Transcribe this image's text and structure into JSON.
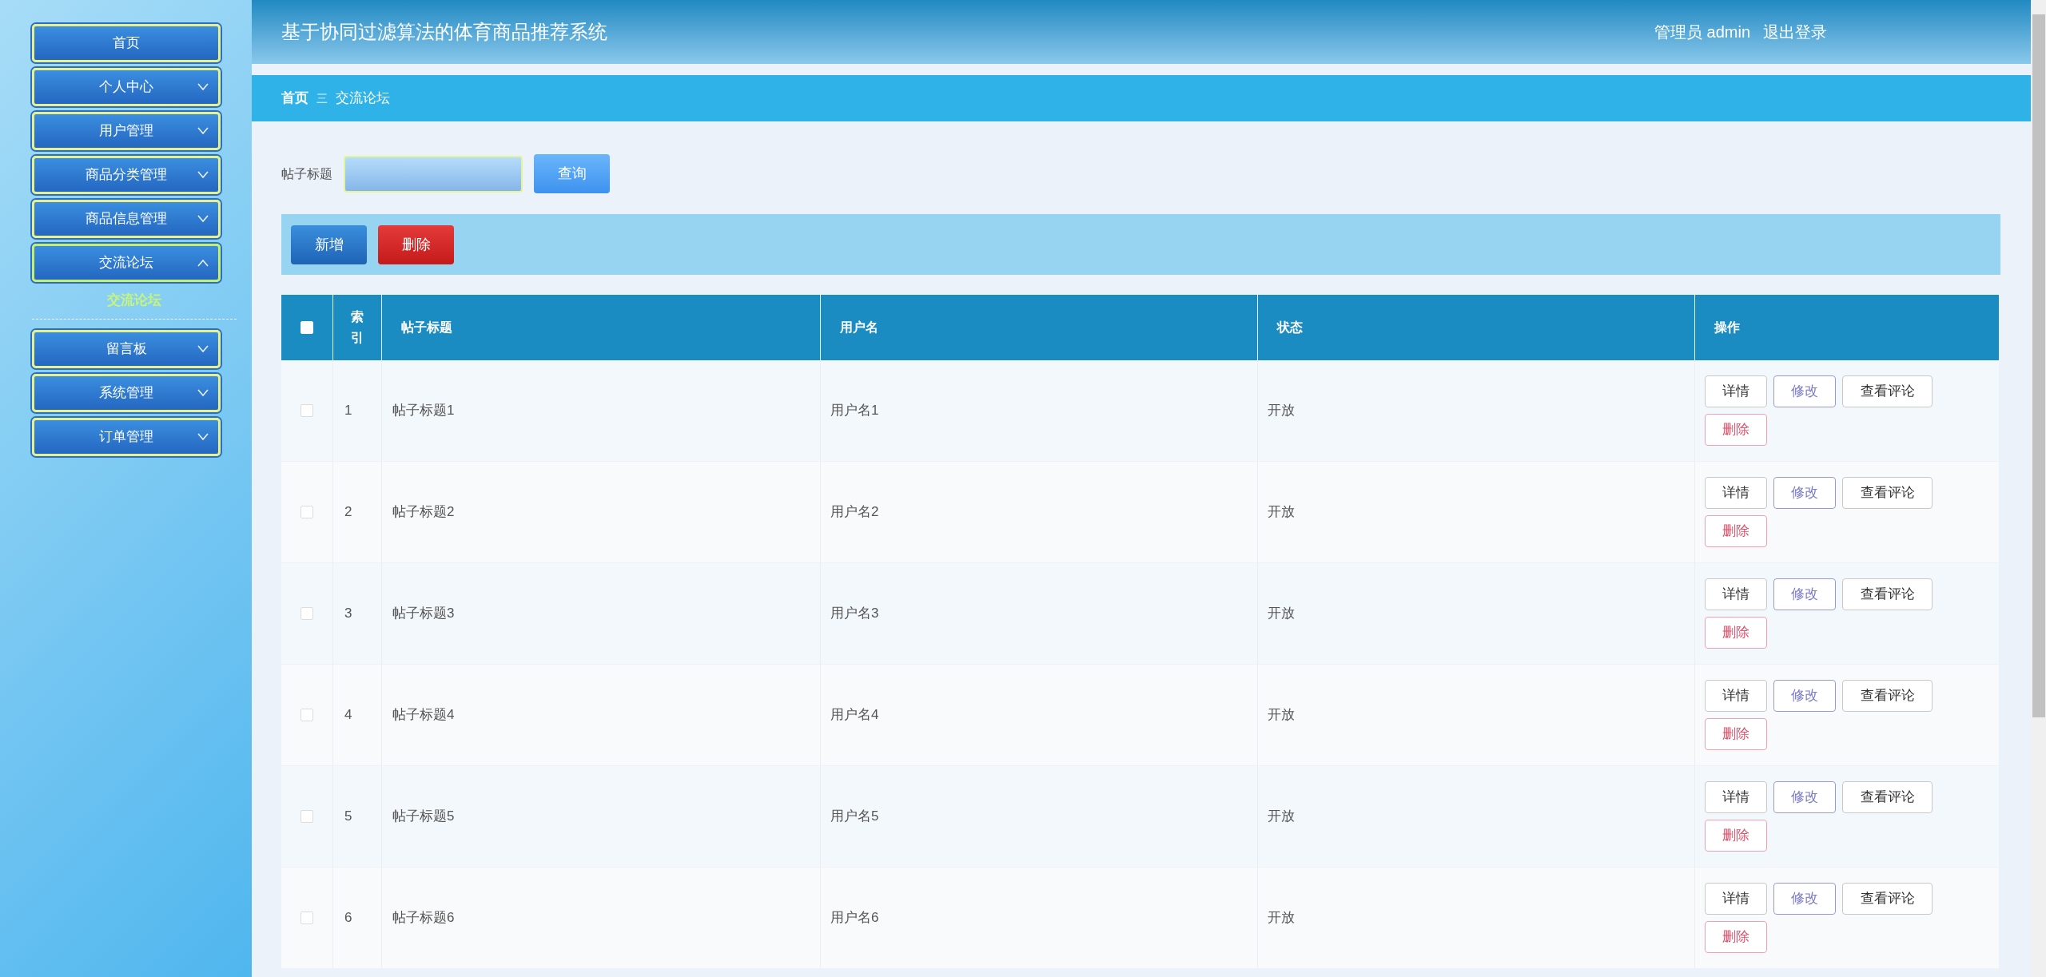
{
  "sidebar": {
    "items": [
      {
        "label": "首页",
        "kind": "link",
        "expanded": false
      },
      {
        "label": "个人中心",
        "kind": "menu",
        "expanded": false
      },
      {
        "label": "用户管理",
        "kind": "menu",
        "expanded": false
      },
      {
        "label": "商品分类管理",
        "kind": "menu",
        "expanded": false
      },
      {
        "label": "商品信息管理",
        "kind": "menu",
        "expanded": false
      },
      {
        "label": "交流论坛",
        "kind": "menu",
        "expanded": true,
        "children": [
          {
            "label": "交流论坛",
            "selected": true
          }
        ]
      },
      {
        "label": "留言板",
        "kind": "menu",
        "expanded": false
      },
      {
        "label": "系统管理",
        "kind": "menu",
        "expanded": false
      },
      {
        "label": "订单管理",
        "kind": "menu",
        "expanded": false
      }
    ]
  },
  "header": {
    "title": "基于协同过滤算法的体育商品推荐系统",
    "user": "管理员 admin",
    "logout": "退出登录"
  },
  "breadcrumb": {
    "home": "首页",
    "separator": "三",
    "current": "交流论坛"
  },
  "search": {
    "label": "帖子标题",
    "button": "查询"
  },
  "actions": [
    "新增",
    "删除"
  ],
  "table": {
    "select_all": {
      "checked": false
    },
    "columns": [
      "索引",
      "帖子标题",
      "用户名",
      "状态",
      "操作"
    ],
    "rows": [
      {
        "checked": false,
        "index": "1",
        "title": "帖子标题1",
        "username": "用户名1",
        "status": "开放",
        "buttons": [
          "详情",
          "修改",
          "查看评论",
          "删除"
        ]
      },
      {
        "checked": false,
        "index": "2",
        "title": "帖子标题2",
        "username": "用户名2",
        "status": "开放",
        "buttons": [
          "详情",
          "修改",
          "查看评论",
          "删除"
        ]
      },
      {
        "checked": false,
        "index": "3",
        "title": "帖子标题3",
        "username": "用户名3",
        "status": "开放",
        "buttons": [
          "详情",
          "修改",
          "查看评论",
          "删除"
        ]
      },
      {
        "checked": false,
        "index": "4",
        "title": "帖子标题4",
        "username": "用户名4",
        "status": "开放",
        "buttons": [
          "详情",
          "修改",
          "查看评论",
          "删除"
        ]
      },
      {
        "checked": false,
        "index": "5",
        "title": "帖子标题5",
        "username": "用户名5",
        "status": "开放",
        "buttons": [
          "详情",
          "修改",
          "查看评论",
          "删除"
        ]
      },
      {
        "checked": false,
        "index": "6",
        "title": "帖子标题6",
        "username": "用户名6",
        "status": "开放",
        "buttons": [
          "详情",
          "修改",
          "查看评论",
          "删除"
        ]
      }
    ]
  }
}
